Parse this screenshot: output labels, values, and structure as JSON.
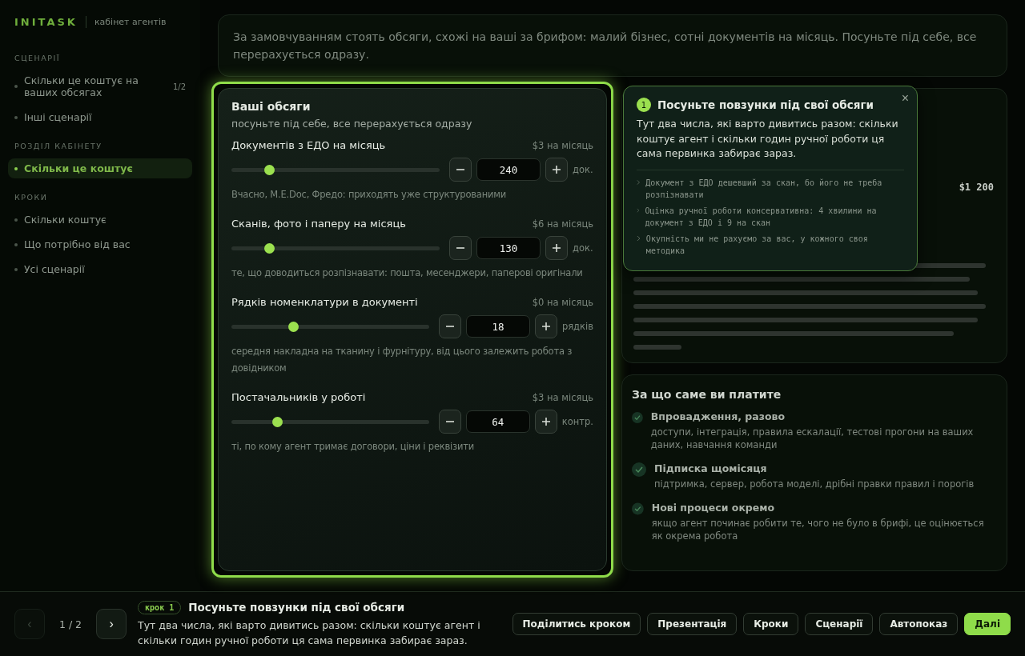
{
  "sidebar": {
    "logo": "INITASK",
    "subtitle": "кабінет агентів",
    "sections": [
      {
        "title": "СЦЕНАРІЇ",
        "items": [
          {
            "label": "Скільки це коштує на ваших обсягах",
            "count": "1/2",
            "selected": false
          },
          {
            "label": "Інші сценарії",
            "selected": false
          }
        ]
      },
      {
        "title": "РОЗДІЛ КАБІНЕТУ",
        "items": [
          {
            "label": "Скільки це коштує",
            "selected": true
          }
        ]
      },
      {
        "title": "КРОКИ",
        "items": [
          {
            "label": "Скільки коштує",
            "selected": false
          },
          {
            "label": "Що потрібно від вас",
            "selected": false
          },
          {
            "label": "Усі сценарії",
            "selected": false
          }
        ]
      }
    ]
  },
  "intro": "За замовчуванням стоять обсяги, схожі на ваші за брифом: малий бізнес, сотні документів на місяць. Посуньте під себе, все перерахується одразу.",
  "volumes": {
    "title": "Ваші обсяги",
    "subtitle": "посуньте під себе, все перерахується одразу",
    "sliders": [
      {
        "label": "Документів з ЕДО на місяць",
        "price": "$3 на місяць",
        "level": 0.18,
        "value": "240",
        "unit": "док.",
        "hint": "Вчасно, M.E.Doc, Фредо: приходять уже структурованими"
      },
      {
        "label": "Сканів, фото і паперу на місяць",
        "price": "$6 на місяць",
        "level": 0.18,
        "value": "130",
        "unit": "док.",
        "hint": "те, що доводиться розпізнавати: пошта, месенджери, паперові оригінали"
      },
      {
        "label": "Рядків номенклатури в документі",
        "price": "$0 на місяць",
        "level": 0.31,
        "value": "18",
        "unit": "рядків",
        "hint": "середня накладна на тканину і фурнітуру, від цього залежить робота з довідником"
      },
      {
        "label": "Постачальників у роботі",
        "price": "$3 на місяць",
        "level": 0.23,
        "value": "64",
        "unit": "контр.",
        "hint": "ті, по кому агент тримає договори, ціни і реквізити"
      }
    ]
  },
  "cost_panel": {
    "total": "$1 200"
  },
  "payments": {
    "title": "За що саме ви платите",
    "items": [
      {
        "title": "Впровадження, разово",
        "text": "доступи, інтеграція, правила ескалації, тестові прогони на ваших даних, навчання команди"
      },
      {
        "title": "Підписка щомісяця",
        "text": "підтримка, сервер, робота моделі, дрібні правки правил і порогів"
      },
      {
        "title": "Нові процеси окремо",
        "text": "якщо агент починає робити те, чого не було в брифі, це оцінюється як окрема робота"
      }
    ]
  },
  "tooltip": {
    "number": "1",
    "title": "Посуньте повзунки під свої обсяги",
    "text": "Тут два числа, які варто дивитись разом: скільки коштує агент і скільки годин ручної роботи ця сама первинка забирає зараз.",
    "close": "×",
    "notes": [
      "Документ з ЕДО дешевший за скан, бо його не треба розпізнавати",
      "Оцінка ручної роботи консервативна: 4 хвилини на документ з ЕДО і 9 на скан",
      "Окупність ми не рахуємо за вас, у кожного своя методика"
    ]
  },
  "tour_bar": {
    "prev": {
      "label": "‹",
      "disabled": true
    },
    "counter": "1 / 2",
    "next": {
      "label": "›",
      "disabled": false
    },
    "badge": "крок 1",
    "title": "Посуньте повзунки під свої обсяги",
    "text": "Тут два числа, які варто дивитись разом: скільки коштує агент і скільки годин ручної роботи ця сама первинка забирає зараз.",
    "buttons": [
      {
        "label": "Поділитись кроком",
        "kind": "outline"
      },
      {
        "label": "Презентація",
        "kind": "outline"
      },
      {
        "label": "Кроки",
        "kind": "outline"
      },
      {
        "label": "Сценарії",
        "kind": "outline"
      },
      {
        "label": "Автопоказ",
        "kind": "outline"
      },
      {
        "label": "Далі",
        "kind": "primary"
      }
    ]
  }
}
